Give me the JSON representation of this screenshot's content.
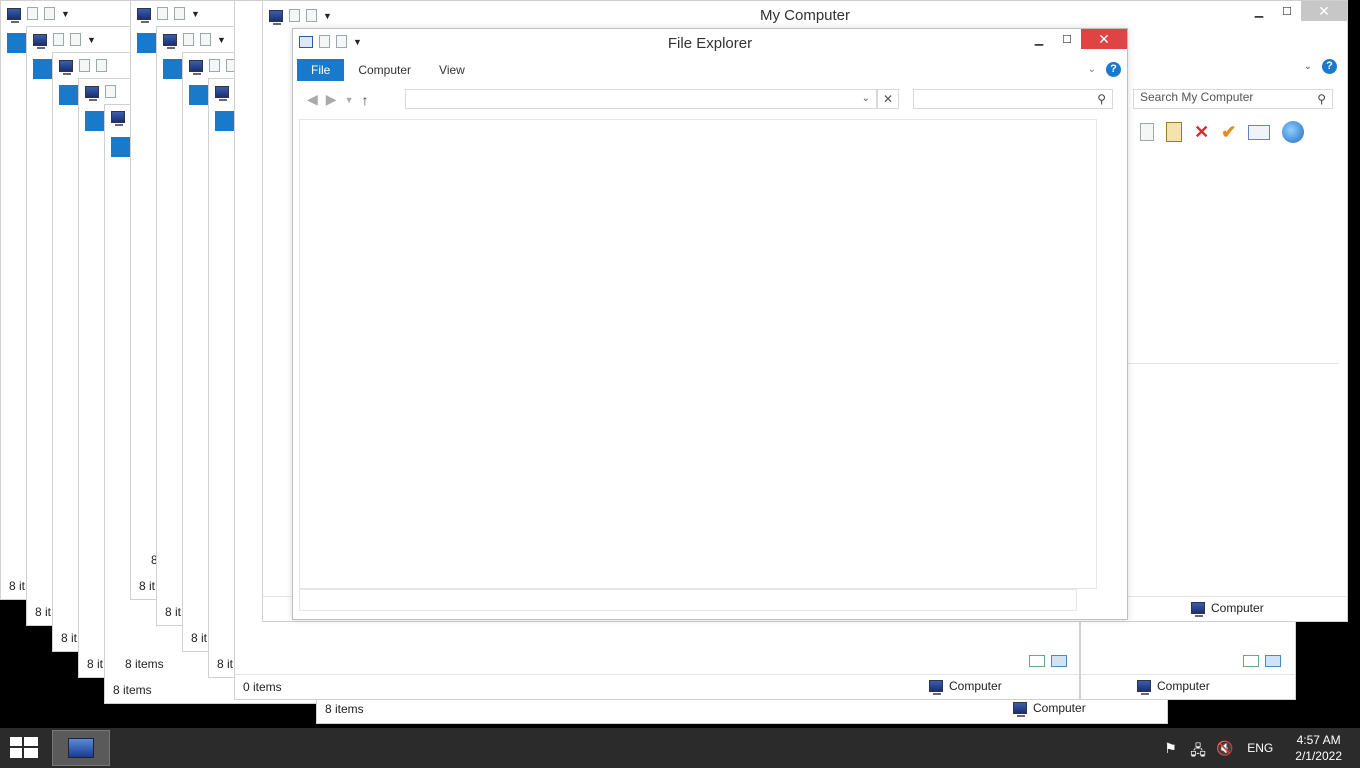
{
  "ghost_windows": {
    "status_texts": [
      "8 it",
      "8 it",
      "8 it",
      "8 it",
      "8 items",
      "8 it",
      "8 it",
      "8 it",
      "8 it",
      "0 items"
    ],
    "partial_count": "8"
  },
  "my_computer": {
    "title": "My Computer",
    "search_placeholder": "Search My Computer",
    "status_left": "",
    "status_location": "Computer"
  },
  "mid_window": {
    "status_left": "0 items",
    "status_location": "Computer"
  },
  "right_window": {
    "status_location": "Computer"
  },
  "front_window": {
    "title": "File Explorer",
    "tabs": [
      "File",
      "Computer",
      "View"
    ]
  },
  "bottom_window": {
    "status_left": "8 items",
    "status_location": "Computer"
  },
  "left_window": {
    "status_left": "8 items"
  },
  "taskbar": {
    "language": "ENG",
    "time": "4:57 AM",
    "date": "2/1/2022"
  }
}
